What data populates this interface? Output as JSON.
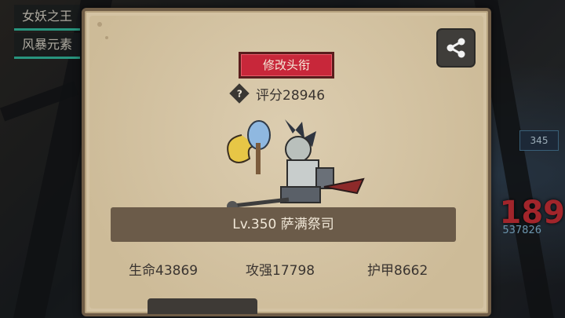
{
  "background": {
    "side_tags": [
      "女妖之王",
      "风暴元素"
    ],
    "right_numbers": [
      "345",
      "189",
      "537826"
    ]
  },
  "panel": {
    "title_button_label": "修改头衔",
    "score_text": "评分28946",
    "hero_name_text": "Lv.350 萨满祭司",
    "stats": {
      "hp_text": "生命43869",
      "attack_text": "攻强17798",
      "armor_text": "护甲8662"
    }
  },
  "icons": {
    "share": "share-icon",
    "help": "question-diamond-icon"
  },
  "colors": {
    "panel_bg": "#d4c3a3",
    "panel_border": "#6f5c46",
    "title_button": "#c8273a",
    "name_bar": "#6b5b49",
    "accent_teal": "#36c6a8"
  }
}
